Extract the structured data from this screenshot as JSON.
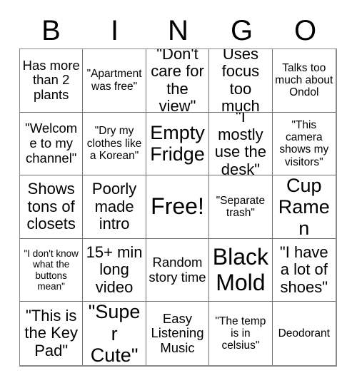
{
  "header": {
    "letters": [
      "B",
      "I",
      "N",
      "G",
      "O"
    ]
  },
  "grid": {
    "rows": 5,
    "columns": 5,
    "border_color": "#8a8a8a",
    "grid_line_color": "#6f6f6f",
    "background_color": "#ffffff",
    "text_color": "#000000"
  },
  "cells": [
    {
      "text": "Has more than 2 plants",
      "size": "md"
    },
    {
      "text": "\"Apartment was free\"",
      "size": "sm"
    },
    {
      "text": "\"Don't care for the view\"",
      "size": "lg"
    },
    {
      "text": "Uses focus too much",
      "size": "lg"
    },
    {
      "text": "Talks too much about Ondol",
      "size": "sm"
    },
    {
      "text": "\"Welcome to my channel\"",
      "size": "md"
    },
    {
      "text": "\"Dry my clothes like a Korean\"",
      "size": "sm"
    },
    {
      "text": "Empty Fridge",
      "size": "xl"
    },
    {
      "text": "\"I mostly use the desk\"",
      "size": "lg"
    },
    {
      "text": "\"This camera shows my visitors\"",
      "size": "sm"
    },
    {
      "text": "Shows tons of closets",
      "size": "lg"
    },
    {
      "text": "Poorly made intro",
      "size": "lg"
    },
    {
      "text": "Free!",
      "size": "xxl"
    },
    {
      "text": "\"Separate trash\"",
      "size": "sm"
    },
    {
      "text": "Cup Ramen",
      "size": "xl"
    },
    {
      "text": "\"I don't know what the buttons mean\"",
      "size": "xs"
    },
    {
      "text": "15+ min long video",
      "size": "lg"
    },
    {
      "text": "Random story time",
      "size": "md"
    },
    {
      "text": "Black Mold",
      "size": "xxl"
    },
    {
      "text": "\"I have a lot of shoes\"",
      "size": "lg"
    },
    {
      "text": "\"This is the Key Pad\"",
      "size": "lg"
    },
    {
      "text": "\"Super Cute\"",
      "size": "xl"
    },
    {
      "text": "Easy Listening Music",
      "size": "md"
    },
    {
      "text": "\"The temp is in celsius\"",
      "size": "sm"
    },
    {
      "text": "Deodorant",
      "size": "sm"
    }
  ]
}
